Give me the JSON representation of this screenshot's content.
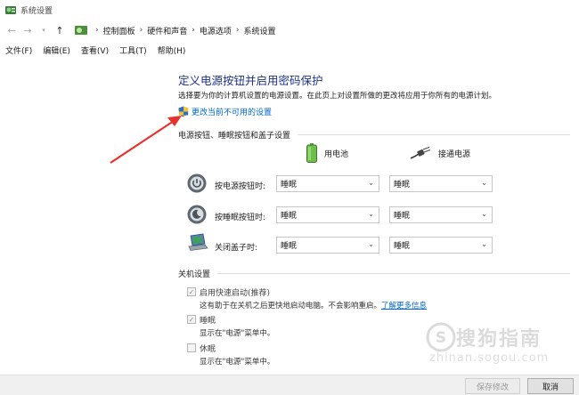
{
  "window": {
    "title": "系统设置",
    "icons": {
      "app": "control-panel-icon"
    }
  },
  "address": {
    "crumbs": [
      "控制面板",
      "硬件和声音",
      "电源选项",
      "系统设置"
    ]
  },
  "menu": [
    "文件(F)",
    "编辑(E)",
    "查看(V)",
    "工具(T)",
    "帮助(H)"
  ],
  "main": {
    "title": "定义电源按钮并启用密码保护",
    "description": "选择要为你的计算机设置的电源设置。在此页上对设置所做的更改将应用于你所有的电源计划。",
    "change_link": "更改当前不可用的设置"
  },
  "power_section": {
    "header": "电源按钮、睡眠按钮和盖子设置",
    "col_battery": "用电池",
    "col_plugged": "接通电源",
    "rows": [
      {
        "label": "按电源按钮时:",
        "battery": "睡眠",
        "plugged": "睡眠"
      },
      {
        "label": "按睡眠按钮时:",
        "battery": "睡眠",
        "plugged": "睡眠"
      },
      {
        "label": "关闭盖子时:",
        "battery": "睡眠",
        "plugged": "睡眠"
      }
    ]
  },
  "shutdown_section": {
    "header": "关机设置",
    "items": [
      {
        "label": "启用快速启动(推荐)",
        "checked": true,
        "desc": "这有助于在关机之后更快地启动电脑。不会影响重启。",
        "link": "了解更多信息"
      },
      {
        "label": "睡眠",
        "checked": true,
        "desc": "显示在\"电源\"菜单中。"
      },
      {
        "label": "休眠",
        "checked": false,
        "desc": "显示在\"电源\"菜单中。"
      }
    ]
  },
  "footer": {
    "save": "保存修改",
    "cancel": "取消"
  },
  "watermark": {
    "text": "搜狗指南",
    "url": "zhinan.sogou.com"
  },
  "colors": {
    "title_blue": "#1e3287",
    "link_blue": "#0066cc",
    "arrow_red": "#e8322d"
  }
}
